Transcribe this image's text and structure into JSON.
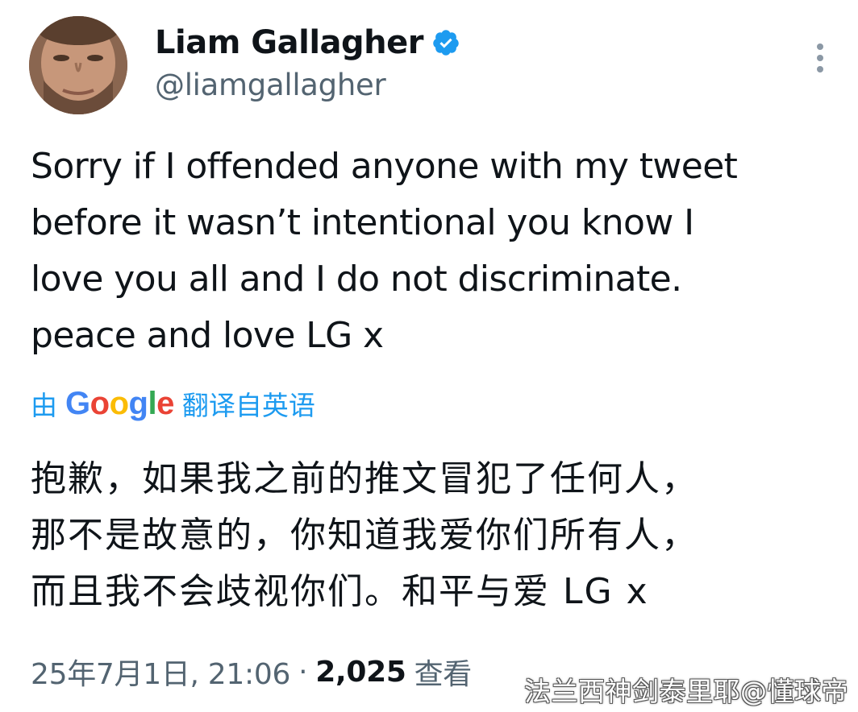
{
  "author": {
    "name": "Liam Gallagher",
    "handle": "@liamgallagher",
    "verified": true
  },
  "tweet": {
    "text": "Sorry if I offended anyone with my tweet\nbefore it wasn’t intentional you know I\nlove you all and I do not discriminate.\npeace and love LG x"
  },
  "translation": {
    "prefix": "由",
    "provider_logo": "Google",
    "suffix": "翻译自英语",
    "text": "抱歉，如果我之前的推文冒犯了任何人，\n那不是故意的，你知道我爱你们所有人，\n而且我不会歧视你们。和平与爱 LG x"
  },
  "meta": {
    "timestamp": "25年7月1日, 21:06",
    "separator": "·",
    "view_count": "2,025",
    "views_label": "查看"
  },
  "watermark": "法兰西神剑泰里耶@懂球帝",
  "icons": {
    "verified": "verified-badge-icon",
    "more": "more-options-icon"
  },
  "colors": {
    "text_primary": "#0f1419",
    "text_secondary": "#536471",
    "accent": "#1d9bf0"
  }
}
